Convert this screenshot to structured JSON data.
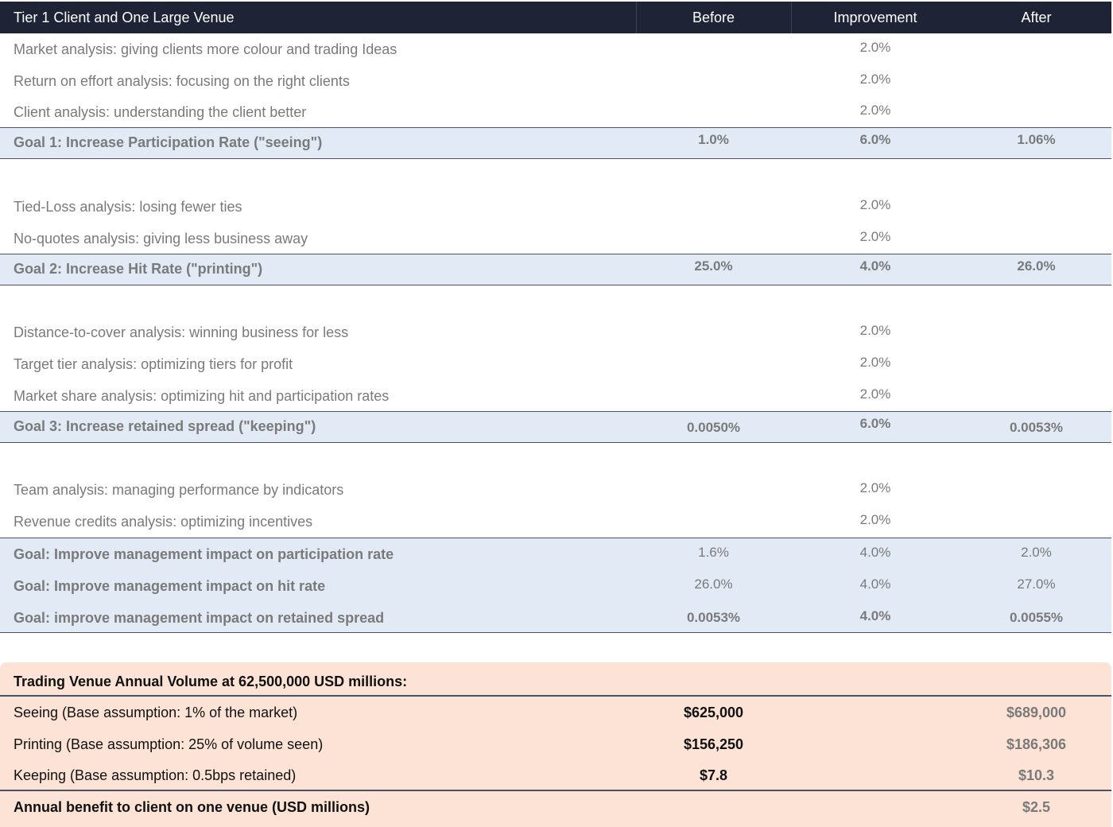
{
  "header": {
    "title": "Tier 1 Client and One Large Venue",
    "col_before": "Before",
    "col_improvement": "Improvement",
    "col_after": "After"
  },
  "section1": {
    "rows": [
      {
        "label": "Market analysis: giving clients more colour and trading Ideas",
        "improvement": "2.0%"
      },
      {
        "label": "Return on effort analysis: focusing on the right clients",
        "improvement": "2.0%"
      },
      {
        "label": "Client analysis: understanding the client better",
        "improvement": "2.0%"
      }
    ],
    "goal": {
      "label": "Goal 1: Increase Participation Rate (\"seeing\")",
      "before": "1.0%",
      "improvement": "6.0%",
      "after": "1.06%"
    }
  },
  "section2": {
    "rows": [
      {
        "label": "Tied-Loss analysis: losing fewer ties",
        "improvement": "2.0%"
      },
      {
        "label": "No-quotes analysis: giving less business away",
        "improvement": "2.0%"
      }
    ],
    "goal": {
      "label": "Goal 2: Increase Hit Rate (\"printing\")",
      "before": "25.0%",
      "improvement": "4.0%",
      "after": "26.0%"
    }
  },
  "section3": {
    "rows": [
      {
        "label": "Distance-to-cover analysis: winning business for less",
        "improvement": "2.0%"
      },
      {
        "label": "Target tier analysis: optimizing tiers for profit",
        "improvement": "2.0%"
      },
      {
        "label": "Market share analysis: optimizing hit and participation rates",
        "improvement": "2.0%"
      }
    ],
    "goal": {
      "label": "Goal 3: Increase retained spread (\"keeping\")",
      "before": "0.0050%",
      "improvement": "6.0%",
      "after": "0.0053%"
    }
  },
  "section4": {
    "rows": [
      {
        "label": "Team analysis: managing performance by indicators",
        "improvement": "2.0%"
      },
      {
        "label": "Revenue credits analysis: optimizing incentives",
        "improvement": "2.0%"
      }
    ],
    "goals": [
      {
        "label": "Goal: Improve management impact on participation rate",
        "before": "1.6%",
        "improvement": "4.0%",
        "after": "2.0%"
      },
      {
        "label": "Goal: Improve management impact on hit rate",
        "before": "26.0%",
        "improvement": "4.0%",
        "after": "27.0%"
      },
      {
        "label": "Goal: improve management impact on retained spread",
        "before": "0.0053%",
        "improvement": "4.0%",
        "after": "0.0055%"
      }
    ]
  },
  "summary": {
    "title": "Trading Venue Annual Volume at 62,500,000 USD millions:",
    "rows": [
      {
        "label": "Seeing (Base assumption: 1% of the market)",
        "before": "$625,000",
        "after": "$689,000"
      },
      {
        "label": "Printing (Base assumption: 25% of volume seen)",
        "before": "$156,250",
        "after": "$186,306"
      },
      {
        "label": "Keeping (Base assumption: 0.5bps retained)",
        "before": "$7.8",
        "after": "$10.3"
      }
    ],
    "benefit": {
      "label": "Annual benefit to client on one venue (USD millions)",
      "after": "$2.5"
    }
  }
}
